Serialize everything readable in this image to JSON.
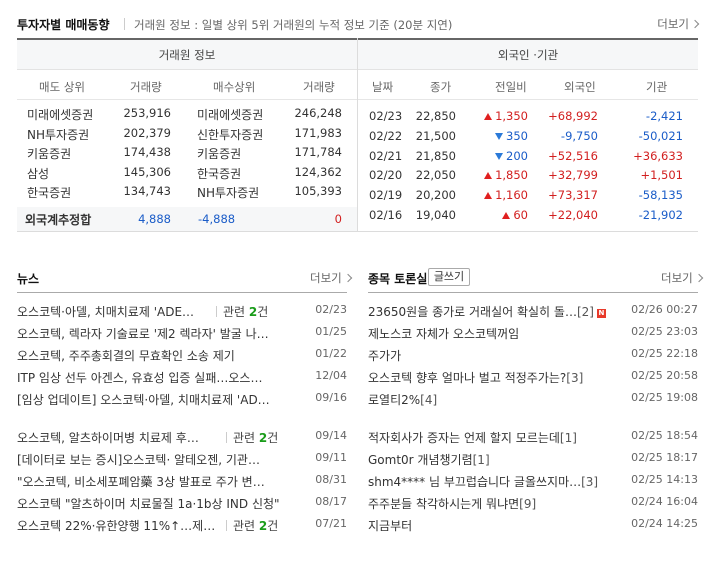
{
  "header": {
    "title": "투자자별 매매동향",
    "subtitle": "거래원 정보 : 일별 상위 5위 거래원의 누적 정보 기준 (20분 지연)",
    "more": "더보기"
  },
  "broker_table": {
    "band": "거래원 정보",
    "cols": [
      "매도 상위",
      "거래량",
      "매수상위",
      "거래량"
    ],
    "rows": [
      {
        "sell": "미래에셋증권",
        "sell_vol": "253,916",
        "buy": "미래에셋증권",
        "buy_vol": "246,248"
      },
      {
        "sell": "NH투자증권",
        "sell_vol": "202,379",
        "buy": "신한투자증권",
        "buy_vol": "171,983"
      },
      {
        "sell": "키움증권",
        "sell_vol": "174,438",
        "buy": "키움증권",
        "buy_vol": "171,784"
      },
      {
        "sell": "삼성",
        "sell_vol": "145,306",
        "buy": "한국증권",
        "buy_vol": "124,362"
      },
      {
        "sell": "한국증권",
        "sell_vol": "134,743",
        "buy": "NH투자증권",
        "buy_vol": "105,393"
      }
    ],
    "foreign": {
      "label": "외국계추정합",
      "sell_vol": "4,888",
      "buy_vol": "-4,888",
      "net": "0"
    }
  },
  "foreign_table": {
    "band": "외국인 ·기관",
    "cols": [
      "날짜",
      "종가",
      "전일비",
      "외국인",
      "기관"
    ],
    "rows": [
      {
        "date": "02/23",
        "close": "22,850",
        "dir": "up",
        "change": "1,350",
        "foreign": "+68,992",
        "inst": "-2,421"
      },
      {
        "date": "02/22",
        "close": "21,500",
        "dir": "down",
        "change": "350",
        "foreign": "-9,750",
        "inst": "-50,021"
      },
      {
        "date": "02/21",
        "close": "21,850",
        "dir": "down",
        "change": "200",
        "foreign": "+52,516",
        "inst": "+36,633"
      },
      {
        "date": "02/20",
        "close": "22,050",
        "dir": "up",
        "change": "1,850",
        "foreign": "+32,799",
        "inst": "+1,501"
      },
      {
        "date": "02/19",
        "close": "20,200",
        "dir": "up",
        "change": "1,160",
        "foreign": "+73,317",
        "inst": "-58,135"
      },
      {
        "date": "02/16",
        "close": "19,040",
        "dir": "up",
        "change": "60",
        "foreign": "+22,040",
        "inst": "-21,902"
      }
    ]
  },
  "news": {
    "title": "뉴스",
    "more": "더보기",
    "items": [
      {
        "title": "오스코텍·아델, 치매치료제 'ADE…",
        "related": true,
        "date": "02/23"
      },
      {
        "title": "오스코텍, 렉라자 기술료로 '제2 렉라자' 발굴 나…",
        "related": false,
        "date": "01/25"
      },
      {
        "title": "오스코텍, 주주총회결의 무효확인 소송 제기",
        "related": false,
        "date": "01/22"
      },
      {
        "title": "ITP 임상 선두 아겐스, 유효성 입증 실패…오스…",
        "related": false,
        "date": "12/04"
      },
      {
        "title": "[임상 업데이트] 오스코텍·아델, 치매치료제 'AD…",
        "related": false,
        "date": "09/16"
      },
      {
        "title": "오스코텍, 알츠하이머병 치료제 후…",
        "related": true,
        "date": "09/14"
      },
      {
        "title": "[데이터로 보는 증시]오스코텍· 알테오젠, 기관…",
        "related": false,
        "date": "09/11"
      },
      {
        "title": "\"오스코텍, 비소세포폐암藥 3상 발표로 주가 변…",
        "related": false,
        "date": "08/31"
      },
      {
        "title": "오스코텍 \"알츠하이머 치료물질 1a·1b상 IND 신청\"",
        "related": false,
        "date": "08/17"
      },
      {
        "title": "오스코텍 22%·유한양행 11%↑…제…",
        "related": true,
        "date": "07/21"
      }
    ],
    "related_label": "관련",
    "related_count": "2",
    "related_unit": "건"
  },
  "board": {
    "title": "종목 토론실",
    "write": "글쓰기",
    "more": "더보기",
    "items": [
      {
        "title": "23650원을 종가로 거래실어 확실히 돌…",
        "count": "[2]",
        "new": true,
        "date": "02/26 00:27"
      },
      {
        "title": "제노스코 자체가 오스코텍꺼임",
        "count": "",
        "new": false,
        "date": "02/25 23:03"
      },
      {
        "title": "주가가",
        "count": "",
        "new": false,
        "date": "02/25 22:18"
      },
      {
        "title": "오스코텍 향후 얼마나 벌고 적정주가는?",
        "count": "[3]",
        "new": false,
        "date": "02/25 20:58"
      },
      {
        "title": "로열티2%",
        "count": "[4]",
        "new": false,
        "date": "02/25 19:08"
      },
      {
        "title": "적자회사가 증자는 언제 할지 모르는데",
        "count": "[1]",
        "new": false,
        "date": "02/25 18:54"
      },
      {
        "title": "Gomt0r 개념챙기렴",
        "count": "[1]",
        "new": false,
        "date": "02/25 18:17"
      },
      {
        "title": "shm4**** 님 부끄럽습니다 글올쓰지마…",
        "count": "[3]",
        "new": false,
        "date": "02/25 14:13"
      },
      {
        "title": "주주분들 착각하시는게 뭐냐면",
        "count": "[9]",
        "new": false,
        "date": "02/24 16:04"
      },
      {
        "title": "지금부터",
        "count": "",
        "new": false,
        "date": "02/24 14:25"
      }
    ],
    "new_badge": "N"
  }
}
